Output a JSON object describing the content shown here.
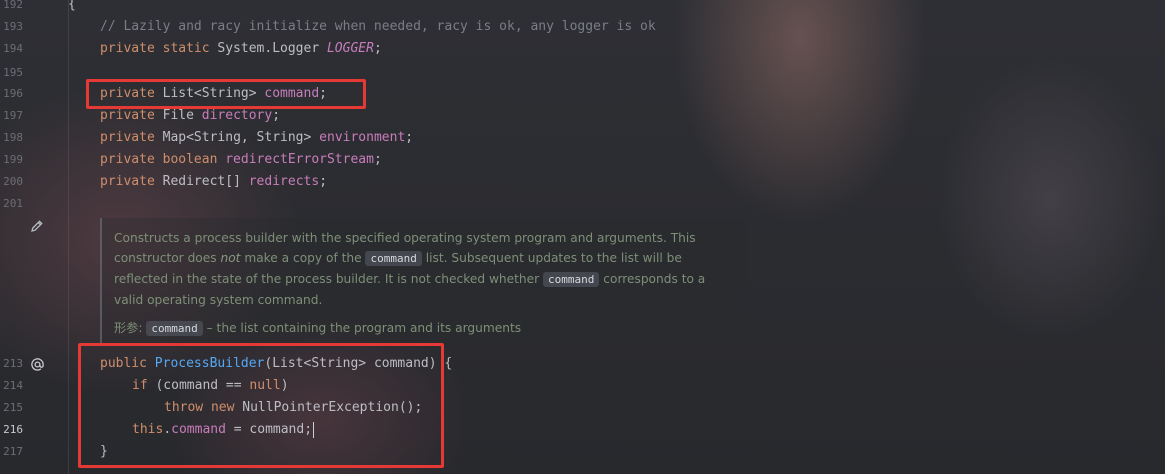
{
  "editor": {
    "line_numbers": [
      "192",
      "193",
      "194",
      "195",
      "196",
      "197",
      "198",
      "199",
      "200",
      "201",
      "213",
      "214",
      "215",
      "216",
      "217"
    ],
    "active_line": "216",
    "gutter_icons": [
      "pencil-icon",
      "at-sign-icon"
    ]
  },
  "code": {
    "l192": "{",
    "l193_comment": "// Lazily and racy initialize when needed, racy is ok, any logger is ok",
    "l194_kw": "private static",
    "l194_type": "System.Logger",
    "l194_field": "LOGGER",
    "l196_kw": "private",
    "l196_type": "List<String>",
    "l196_field": "command",
    "l197_kw": "private",
    "l197_type": "File",
    "l197_field": "directory",
    "l198_kw": "private",
    "l198_type": "Map<String, String>",
    "l198_field": "environment",
    "l199_kw": "private boolean",
    "l199_field": "redirectErrorStream",
    "l200_kw": "private",
    "l200_type": "Redirect[]",
    "l200_field": "redirects",
    "l213_kw": "public",
    "l213_fn": "ProcessBuilder",
    "l213_rest": "(List<String> command) {",
    "l214_kw": "if",
    "l214_a": " (command == ",
    "l214_null": "null",
    "l214_b": ")",
    "l215_kw": "throw new",
    "l215_rest": " NullPointerException();",
    "l216_this": "this",
    "l216_dot": ".",
    "l216_field": "command",
    "l216_rest": " = command;",
    "l217": "}"
  },
  "doc": {
    "p1_a": "Constructs a process builder with the specified operating system program and arguments. This",
    "p1_b": "constructor does ",
    "p1_not": "not",
    "p1_c": " make a copy of the ",
    "p1_chip1": "command",
    "p1_d": " list. Subsequent updates to the list will be",
    "p1_e": "reflected in the state of the process builder. It is not checked whether ",
    "p1_chip2": "command",
    "p1_f": " corresponds to a",
    "p1_g": "valid operating system command.",
    "param_label": "形参:",
    "param_chip": "command",
    "param_desc": " – the list containing the program and its arguments"
  },
  "colors": {
    "highlight_box": "#e53935",
    "keyword": "#cf8e6d",
    "field": "#c77dbb",
    "method": "#56a8f5",
    "comment": "#7a7e85"
  }
}
